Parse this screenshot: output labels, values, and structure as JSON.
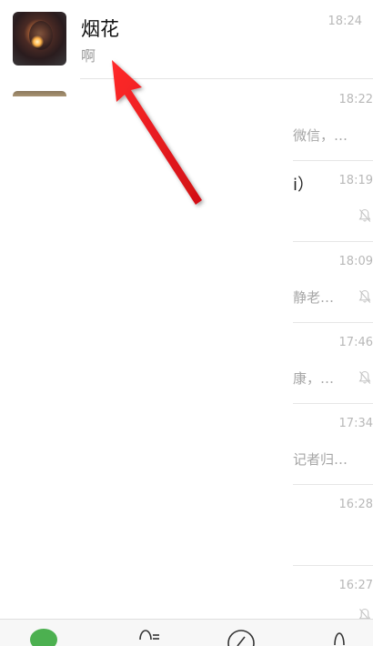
{
  "front_chat": {
    "name": "烟花",
    "preview": "啊",
    "time": "18:24"
  },
  "background_chats": [
    {
      "time": "18:22",
      "preview": "微信，…",
      "muted": false,
      "title": ""
    },
    {
      "time": "18:19",
      "preview": "",
      "muted": true,
      "title": "i）"
    },
    {
      "time": "18:09",
      "preview": "静老…",
      "muted": true,
      "title": ""
    },
    {
      "time": "17:46",
      "preview": "康，…",
      "muted": true,
      "title": ""
    },
    {
      "time": "17:34",
      "preview": "记者归…",
      "muted": false,
      "title": ""
    },
    {
      "time": "16:28",
      "preview": "",
      "muted": false,
      "title": ""
    },
    {
      "time": "16:27",
      "preview": "",
      "muted": true,
      "title": ""
    }
  ],
  "tabbar": {
    "icons": [
      "chats-icon",
      "contacts-icon",
      "discover-icon",
      "me-icon"
    ],
    "accent": "#4cb050"
  },
  "annotation": {
    "color": "#e8141c"
  }
}
